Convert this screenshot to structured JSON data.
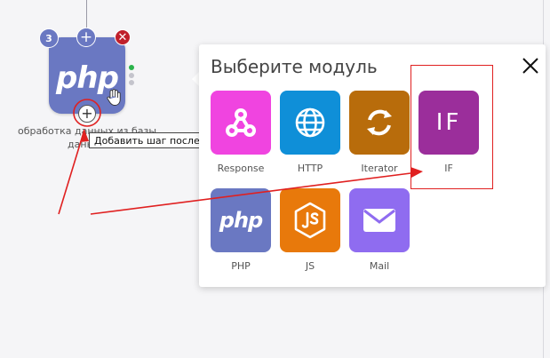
{
  "node": {
    "count": "3",
    "add_symbol": "+",
    "remove_symbol": "✕",
    "logo_text": "php",
    "label": "обработка данных из базы данных",
    "add_after_symbol": "+",
    "tooltip": "Добавить шаг после этого"
  },
  "popup": {
    "title": "Выберите модуль",
    "modules": [
      {
        "label": "Response",
        "color": "#f044e0",
        "icon": "webhook-icon"
      },
      {
        "label": "HTTP",
        "color": "#0f8fd8",
        "icon": "globe-icon"
      },
      {
        "label": "Iterator",
        "color": "#b86c0b",
        "icon": "repeat-icon"
      },
      {
        "label": "IF",
        "color": "#9b2e9b",
        "icon": "if-icon",
        "tile_text": "IF"
      },
      {
        "label": "PHP",
        "color": "#6a78c2",
        "icon": "php-icon",
        "tile_text": "php"
      },
      {
        "label": "JS",
        "color": "#e8790b",
        "icon": "js-icon"
      },
      {
        "label": "Mail",
        "color": "#8f6cf0",
        "icon": "mail-icon"
      }
    ]
  },
  "colors": {
    "annotation": "#e02020",
    "node": "#6a78c2"
  }
}
